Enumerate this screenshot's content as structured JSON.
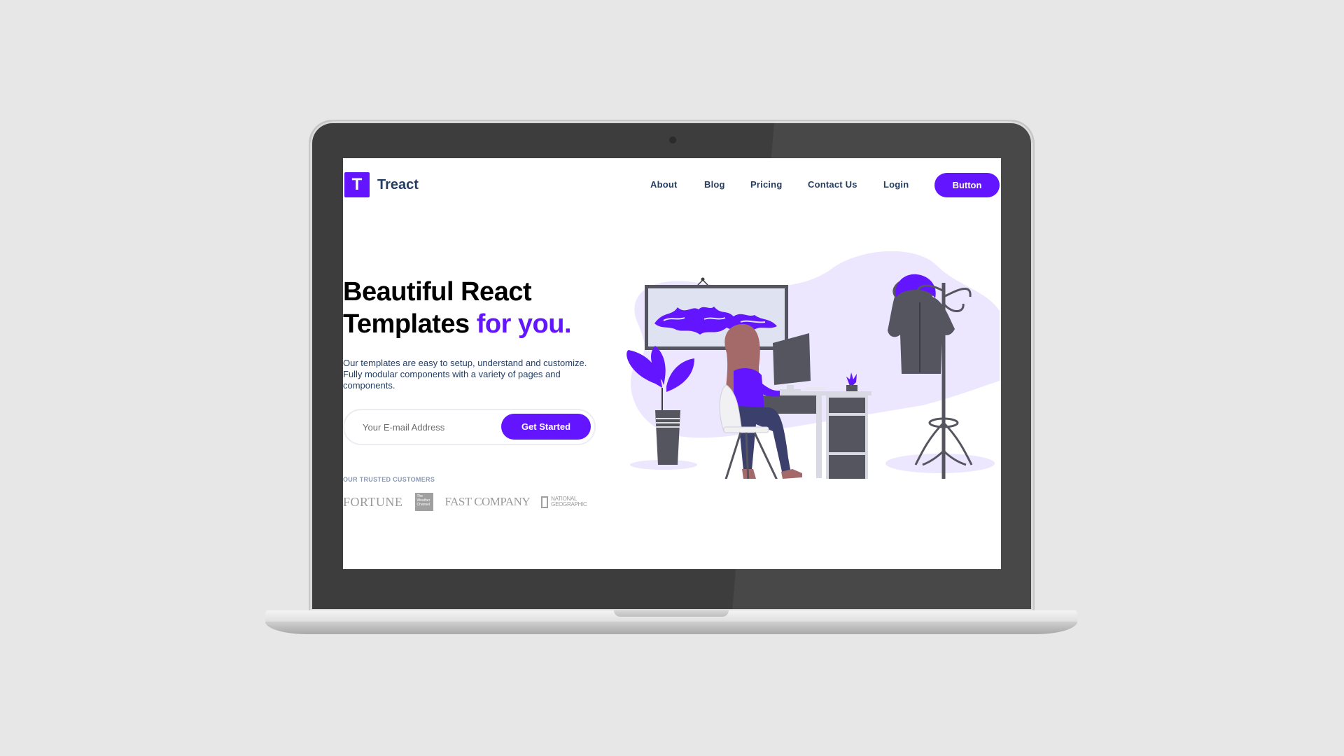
{
  "site": {
    "brand_initial": "T",
    "brand_name": "Treact"
  },
  "nav": {
    "items": [
      {
        "label": "About"
      },
      {
        "label": "Blog"
      },
      {
        "label": "Pricing"
      },
      {
        "label": "Contact Us"
      },
      {
        "label": "Login"
      }
    ],
    "cta_label": "Button"
  },
  "hero": {
    "title_line1": "Beautiful React",
    "title_line2_plain": "Templates ",
    "title_line2_accent": "for you.",
    "description": "Our templates are easy to setup, understand and customize. Fully modular components with a variety of pages and components.",
    "email_placeholder": "Your E-mail Address",
    "submit_label": "Get Started"
  },
  "customers": {
    "label": "OUR TRUSTED CUSTOMERS",
    "logos": [
      {
        "text": "FORTUNE"
      },
      {
        "text": "The Weather Channel"
      },
      {
        "text": "FAST COMPANY"
      },
      {
        "text": "NATIONAL GEOGRAPHIC"
      }
    ]
  },
  "colors": {
    "accent": "#6415ff",
    "heading": "#000000",
    "nav_text": "#243e63",
    "muted": "#8b97b0",
    "background": "#e7e7e7",
    "bezel": "#3d3d3d"
  },
  "icons": {
    "illustration": "woman-at-desk-illustration"
  }
}
